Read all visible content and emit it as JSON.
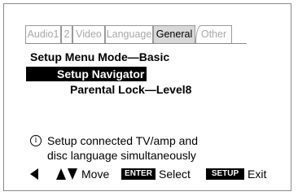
{
  "tabs": [
    {
      "label": "Audio1",
      "active": false
    },
    {
      "label": "2",
      "active": false
    },
    {
      "label": "Video",
      "active": false
    },
    {
      "label": "Language",
      "active": false
    },
    {
      "label": "General",
      "active": true
    },
    {
      "label": "Other",
      "active": false
    }
  ],
  "menu": {
    "mode_label": "Setup Menu Mode",
    "mode_value": "Basic",
    "selected_item": "Setup Navigator",
    "parental_label": "Parental Lock",
    "parental_value": "Level8"
  },
  "info": {
    "icon": "info-icon",
    "line1": "Setup connected TV/amp and",
    "line2": "disc language simultaneously"
  },
  "footer": {
    "back_icon": "left-arrow-icon",
    "updown_icon": "up-down-arrows-icon",
    "move_label": "Move",
    "enter_key": "ENTER",
    "select_label": "Select",
    "setup_key": "SETUP",
    "exit_label": "Exit"
  }
}
